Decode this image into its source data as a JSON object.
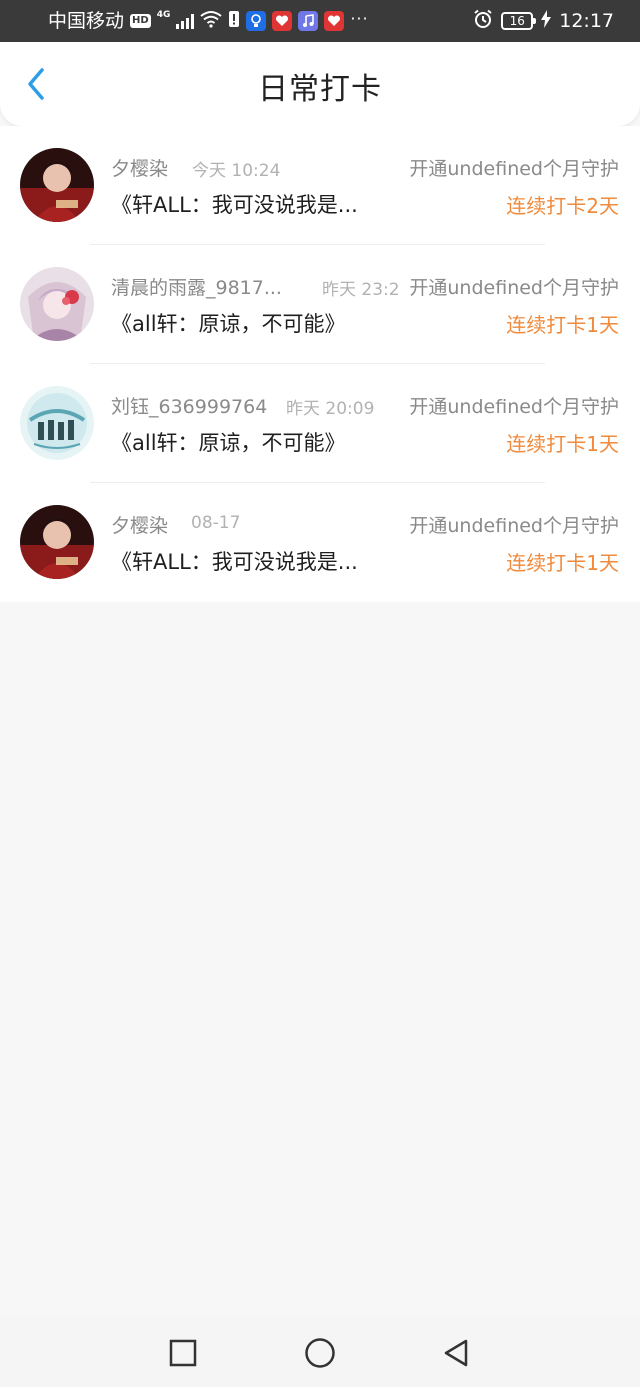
{
  "status_bar": {
    "carrier": "中国移动",
    "hd": "HD",
    "network": "4G",
    "battery": "16",
    "time": "12:17",
    "more": "···"
  },
  "header": {
    "title": "日常打卡",
    "back_icon": "chevron-left-icon"
  },
  "items": [
    {
      "name": "夕樱染",
      "time": "今天 10:24",
      "guard": "开通undefined个月守护",
      "book": "《轩ALL：我可没说我是...",
      "streak": "连续打卡2天",
      "avatar_colors": [
        "#8b1a1a",
        "#2a0f0f"
      ]
    },
    {
      "name": "清晨的雨露_9817...",
      "time": "昨天 23:2",
      "guard": "开通undefined个月守护",
      "book": "《all轩：原谅，不可能》",
      "streak": "连续打卡1天",
      "avatar_colors": [
        "#f0dce8",
        "#b98aa8"
      ]
    },
    {
      "name": "刘钰_636999764",
      "time": "昨天 20:09",
      "guard": "开通undefined个月守护",
      "book": "《all轩：原谅，不可能》",
      "streak": "连续打卡1天",
      "avatar_colors": [
        "#cfe9ee",
        "#5aa6b4"
      ]
    },
    {
      "name": "夕樱染",
      "time": "08-17",
      "guard": "开通undefined个月守护",
      "book": "《轩ALL：我可没说我是...",
      "streak": "连续打卡1天",
      "avatar_colors": [
        "#8b1a1a",
        "#2a0f0f"
      ]
    }
  ],
  "nav": {
    "recent_icon": "square-icon",
    "home_icon": "circle-icon",
    "back_icon": "triangle-back-icon"
  },
  "colors": {
    "accent": "#2f9ee6",
    "streak": "#f08a3c",
    "muted": "#8a8a8a"
  }
}
